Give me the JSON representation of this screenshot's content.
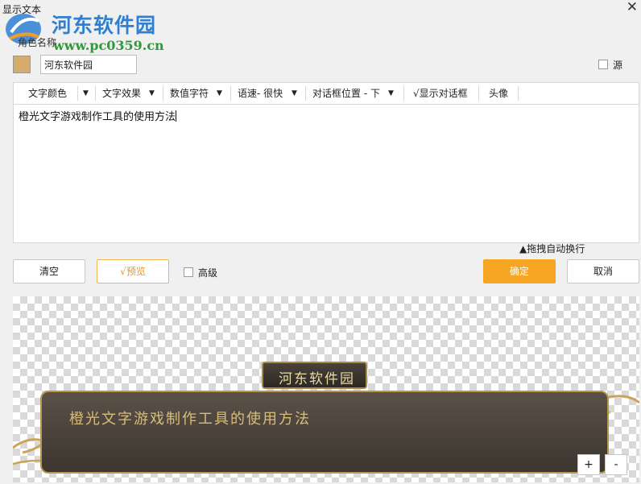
{
  "window": {
    "title": "显示文本",
    "close_glyph": "✕"
  },
  "watermark": {
    "name": "河东软件园",
    "url": "www.pc0359.cn"
  },
  "role": {
    "label": "角色名称",
    "value": "河东软件园",
    "color": "#d6ac6c"
  },
  "source": {
    "label": "源",
    "checked": false
  },
  "toolbar": {
    "text_color": "文字颜色",
    "text_effect": "文字效果",
    "number_char": "数值字符",
    "speed": "语速- 很快",
    "dialog_position": "对话框位置 - 下",
    "show_dialog": "√显示对话框",
    "avatar": "头像"
  },
  "editor": {
    "text": "橙光文字游戏制作工具的使用方法"
  },
  "hint": "▲拖拽自动换行",
  "buttons": {
    "clear": "清空",
    "preview": "√预览",
    "advanced": "高级",
    "ok": "确定",
    "cancel": "取消"
  },
  "preview": {
    "name": "河东软件园",
    "text": "橙光文字游戏制作工具的使用方法",
    "zoom_in": "+",
    "zoom_out": "-"
  },
  "colors": {
    "accent": "#f6a623",
    "preview_border": "#f0b450",
    "dialog_gold": "#d8bd79"
  }
}
